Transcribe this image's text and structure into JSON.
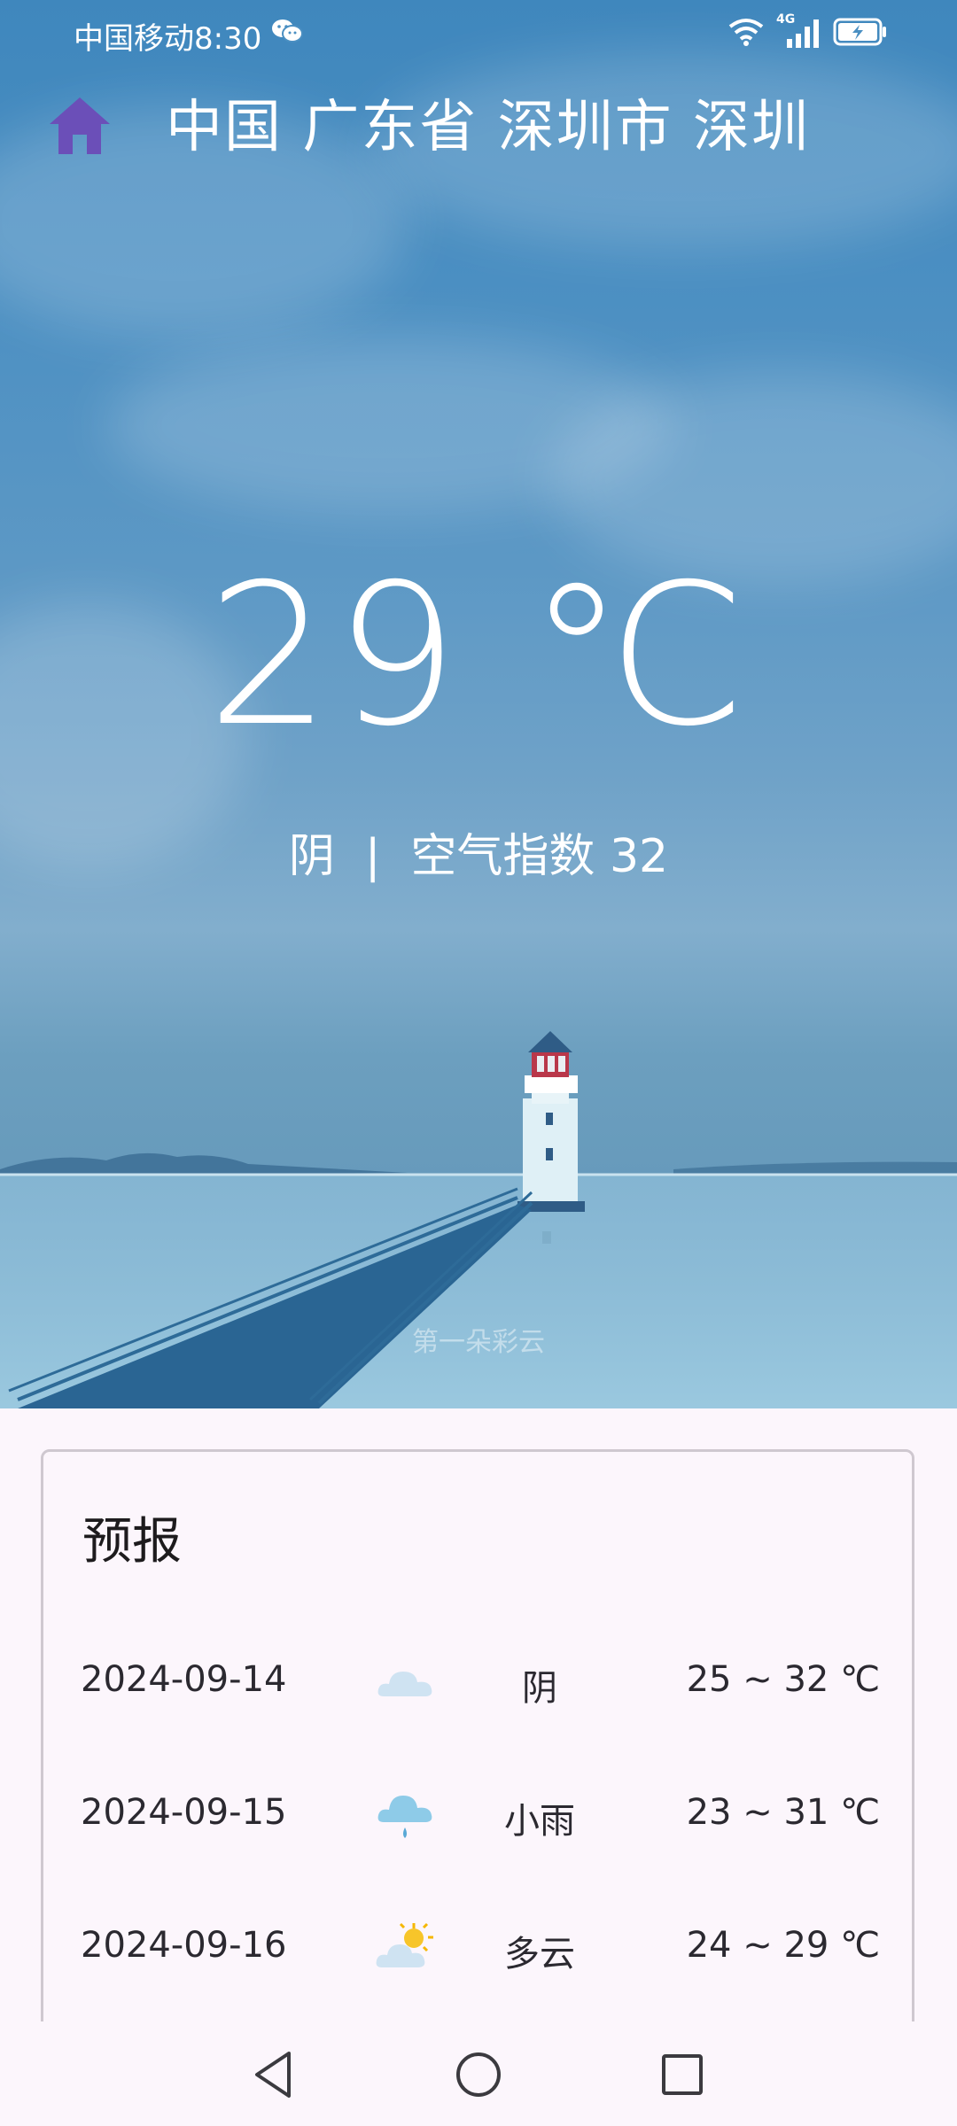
{
  "status_bar": {
    "carrier_time": "中国移动8:30",
    "network_type": "4G",
    "icons": [
      "wechat-icon",
      "wifi-icon",
      "signal-icon",
      "battery-charging-icon"
    ]
  },
  "header": {
    "home_icon": "home-icon",
    "location": "中国 广东省 深圳市 深圳"
  },
  "current": {
    "temperature": "29 ℃",
    "condition": "阴",
    "separator": "|",
    "aqi_text": "空气指数 32"
  },
  "watermark": "第一朵彩云",
  "forecast": {
    "title": "预报",
    "days": [
      {
        "date": "2024-09-14",
        "icon": "cloudy-icon",
        "condition": "阴",
        "range": "25 ~ 32 ℃"
      },
      {
        "date": "2024-09-15",
        "icon": "light-rain-icon",
        "condition": "小雨",
        "range": "23 ~ 31 ℃"
      },
      {
        "date": "2024-09-16",
        "icon": "partly-cloudy-icon",
        "condition": "多云",
        "range": "24 ~ 29 ℃"
      }
    ]
  },
  "nav_bar": {
    "icons": [
      "back-triangle-icon",
      "home-circle-icon",
      "recents-square-icon"
    ]
  },
  "colors": {
    "sky_top": "#3f87bd",
    "sea": "#6c9fbf",
    "card_bg": "#fcf6fc",
    "home_icon": "#6b4fb8",
    "text_dark": "#2b2930"
  }
}
